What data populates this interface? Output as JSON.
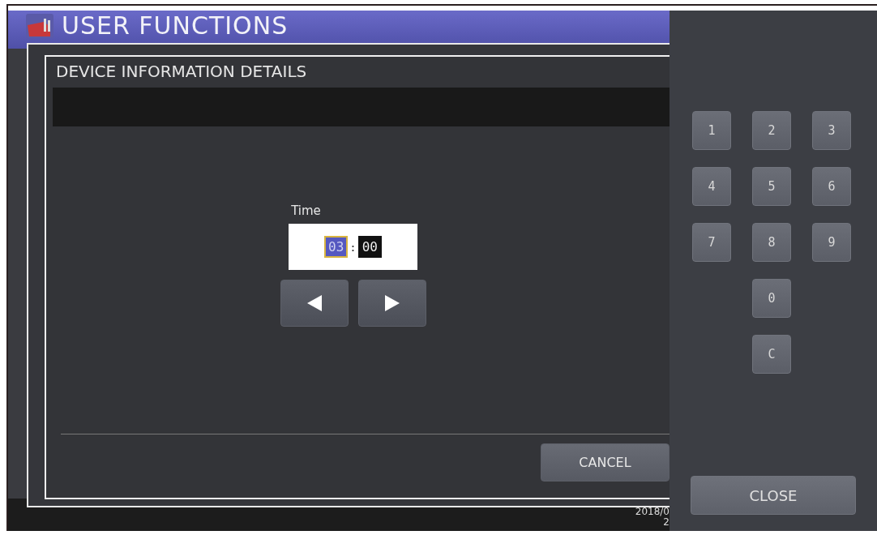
{
  "app": {
    "title": "USER FUNCTIONS",
    "footer_lines": [
      "2018/0",
      "2"
    ]
  },
  "dialog": {
    "title": "DEVICE INFORMATION DETAILS",
    "field_label": "Time",
    "separator": ":",
    "time": [
      {
        "value": "03",
        "selected": true
      },
      {
        "value": "00",
        "selected": false
      }
    ],
    "buttons": [
      "CANCEL"
    ]
  },
  "keypad": {
    "keys": [
      "1",
      "2",
      "3",
      "4",
      "5",
      "6",
      "7",
      "8",
      "9",
      "0",
      "C"
    ],
    "close": "CLOSE"
  }
}
